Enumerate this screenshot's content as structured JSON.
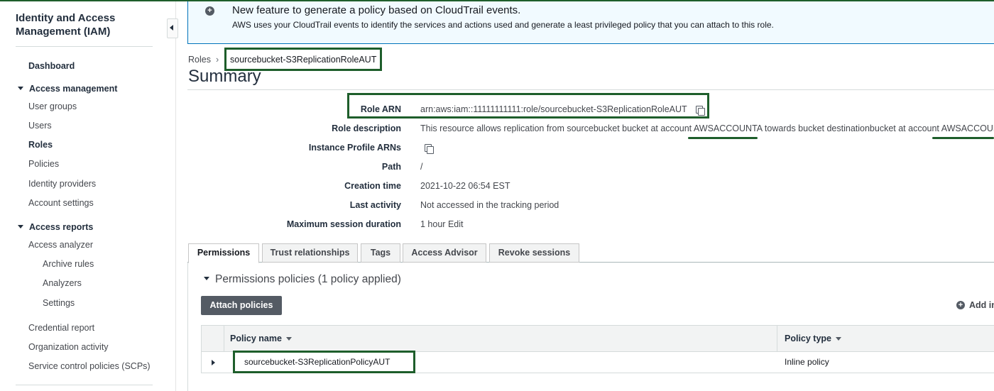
{
  "sidebar": {
    "title": "Identity and Access Management (IAM)",
    "dashboard": "Dashboard",
    "access_management": "Access management",
    "access_management_items": [
      "User groups",
      "Users",
      "Roles",
      "Policies",
      "Identity providers",
      "Account settings"
    ],
    "access_reports": "Access reports",
    "access_analyzer": "Access analyzer",
    "access_analyzer_items": [
      "Archive rules",
      "Analyzers",
      "Settings"
    ],
    "report_items": [
      "Credential report",
      "Organization activity",
      "Service control policies (SCPs)"
    ],
    "active_item": "Roles"
  },
  "banner": {
    "title": "New feature to generate a policy based on CloudTrail events.",
    "text": "AWS uses your CloudTrail events to identify the services and actions used and generate a least privileged policy that you can attach to this role."
  },
  "breadcrumb": {
    "parent": "Roles",
    "separator": "›",
    "current": "sourcebucket-S3ReplicationRoleAUT"
  },
  "page_title": "Summary",
  "summary": {
    "role_arn_label": "Role ARN",
    "role_arn_value": "arn:aws:iam::11111111111:role/sourcebucket-S3ReplicationRoleAUT",
    "role_description_label": "Role description",
    "role_description_value": {
      "part1": "This resource allows replication from sourcebucket bucket at account ",
      "account_a": "AWSACCOUNTA",
      "part2": " towards bucket destinationbucket at account ",
      "account_b": "AWSACCOUNTB"
    },
    "instance_profile_label": "Instance Profile ARNs",
    "path_label": "Path",
    "path_value": "/",
    "creation_time_label": "Creation time",
    "creation_time_value": "2021-10-22 06:54 EST",
    "last_activity_label": "Last activity",
    "last_activity_value": "Not accessed in the tracking period",
    "max_session_label": "Maximum session duration",
    "max_session_value": "1 hour",
    "edit_label": "Edit"
  },
  "tabs": [
    "Permissions",
    "Trust relationships",
    "Tags",
    "Access Advisor",
    "Revoke sessions"
  ],
  "active_tab": "Permissions",
  "permissions": {
    "heading": "Permissions policies (1 policy applied)",
    "attach_button": "Attach policies",
    "add_inline": "Add inline policy",
    "columns": [
      "Policy name",
      "Policy type"
    ],
    "rows": [
      {
        "policy_name": "sourcebucket-S3ReplicationPolicyAUT",
        "policy_type": "Inline policy"
      }
    ]
  },
  "colors": {
    "highlight_box": "#1e5e2b",
    "banner_border": "#0073bb",
    "banner_bg": "#f1faff",
    "button_bg": "#545b64"
  }
}
